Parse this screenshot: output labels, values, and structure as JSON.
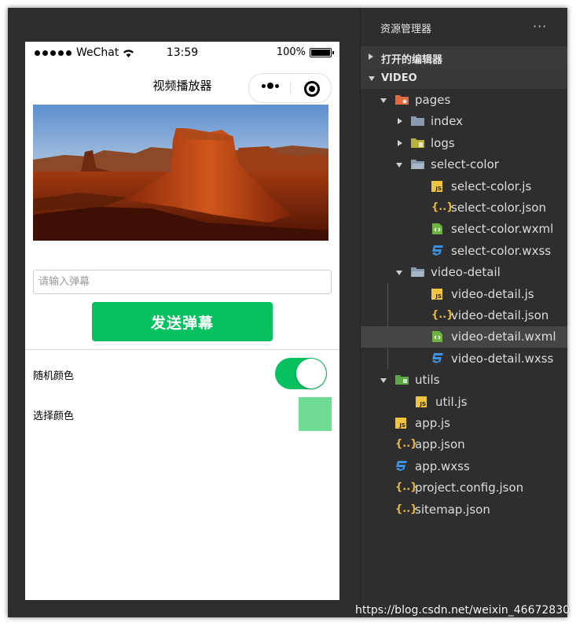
{
  "phone": {
    "statusbar": {
      "carrier": "WeChat",
      "time": "13:59",
      "battery": "100%"
    },
    "navbar": {
      "title": "视频播放器"
    },
    "danmu": {
      "placeholder": "请输入弹幕",
      "send_label": "发送弹幕"
    },
    "settings": {
      "random_color_label": "随机颜色",
      "random_color_on": true,
      "select_color_label": "选择颜色",
      "selected_color": "#6fdc92"
    },
    "accent": "#07c160"
  },
  "explorer": {
    "header": "资源管理器",
    "more": "···",
    "open_editors_label": "打开的编辑器",
    "project_label": "VIDEO",
    "tree": [
      {
        "label": "pages",
        "depth": 0,
        "kind": "folder-pages",
        "expanded": true
      },
      {
        "label": "index",
        "depth": 1,
        "kind": "folder",
        "expanded": false
      },
      {
        "label": "logs",
        "depth": 1,
        "kind": "folder-logs",
        "expanded": false
      },
      {
        "label": "select-color",
        "depth": 1,
        "kind": "folder-open",
        "expanded": true
      },
      {
        "label": "select-color.js",
        "depth": 2,
        "kind": "js"
      },
      {
        "label": "select-color.json",
        "depth": 2,
        "kind": "json"
      },
      {
        "label": "select-color.wxml",
        "depth": 2,
        "kind": "wxml"
      },
      {
        "label": "select-color.wxss",
        "depth": 2,
        "kind": "wxss"
      },
      {
        "label": "video-detail",
        "depth": 1,
        "kind": "folder-open",
        "expanded": true
      },
      {
        "label": "video-detail.js",
        "depth": 2,
        "kind": "js"
      },
      {
        "label": "video-detail.json",
        "depth": 2,
        "kind": "json"
      },
      {
        "label": "video-detail.wxml",
        "depth": 2,
        "kind": "wxml",
        "selected": true
      },
      {
        "label": "video-detail.wxss",
        "depth": 2,
        "kind": "wxss"
      },
      {
        "label": "utils",
        "depth": 0,
        "kind": "folder-utils",
        "expanded": true
      },
      {
        "label": "util.js",
        "depth": 1,
        "kind": "js"
      },
      {
        "label": "app.js",
        "depth": 0,
        "kind": "js",
        "leaf_root": true
      },
      {
        "label": "app.json",
        "depth": 0,
        "kind": "json",
        "leaf_root": true
      },
      {
        "label": "app.wxss",
        "depth": 0,
        "kind": "wxss",
        "leaf_root": true
      },
      {
        "label": "project.config.json",
        "depth": 0,
        "kind": "json",
        "leaf_root": true
      },
      {
        "label": "sitemap.json",
        "depth": 0,
        "kind": "json",
        "leaf_root": true
      }
    ]
  },
  "icons": {
    "js_text": "JS",
    "json_text": "{..}",
    "css_text": "3"
  },
  "watermark": "https://blog.csdn.net/weixin_46672830"
}
